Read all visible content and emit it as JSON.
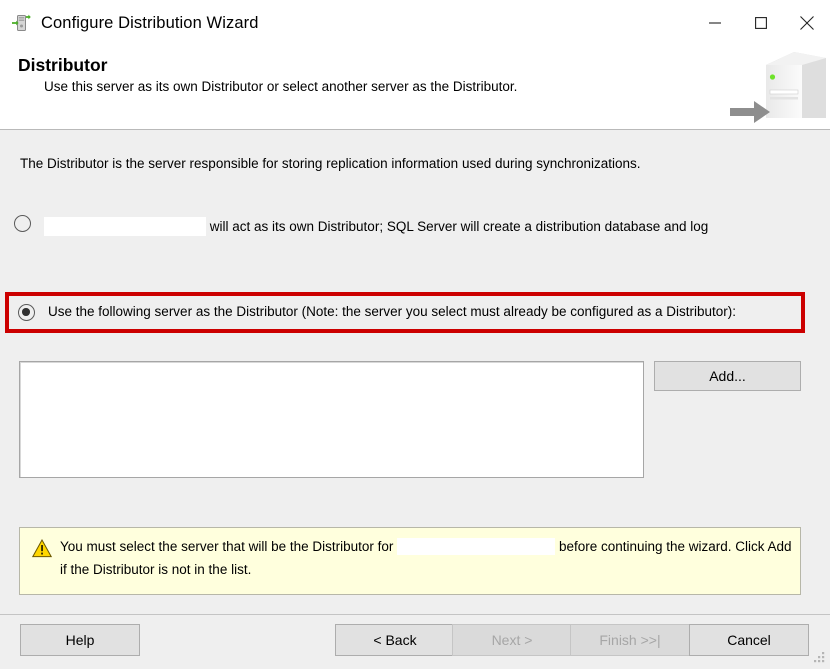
{
  "window": {
    "title": "Configure Distribution Wizard",
    "icon": "replication-server-icon",
    "controls": {
      "minimize_label": "Minimize",
      "maximize_label": "Maximize",
      "close_label": "Close"
    }
  },
  "header": {
    "title": "Distributor",
    "subtitle": "Use this server as its own Distributor or select another server as the Distributor.",
    "art": "server-tower-with-arrow-graphic"
  },
  "main": {
    "intro": "The Distributor is the server responsible for storing replication information used during synchronizations.",
    "options": [
      {
        "id": "own-distributor",
        "selected": false,
        "redacted_server_name": "",
        "text_after": "will act as its own Distributor; SQL Server will create a distribution database and log",
        "highlighted": false
      },
      {
        "id": "following-server",
        "selected": true,
        "text": "Use the following server as the Distributor (Note: the server you select must already be configured as a Distributor):",
        "highlighted": true,
        "highlight_color": "#cc0000"
      }
    ],
    "server_list": {
      "name": "distributor-server-list",
      "items": [],
      "empty": true
    },
    "add_button_label": "Add...",
    "warning": {
      "icon": "warning-triangle-icon",
      "text_before": "You must select the server that will be the Distributor for",
      "redacted_server_name": "",
      "text_after": "before continuing the wizard. Click Add if the Distributor is not in the list.",
      "background": "#ffffdd"
    }
  },
  "footer": {
    "buttons": [
      {
        "id": "help",
        "label": "Help",
        "enabled": true
      },
      {
        "id": "back",
        "label": "< Back",
        "enabled": true
      },
      {
        "id": "next",
        "label": "Next >",
        "enabled": false
      },
      {
        "id": "finish",
        "label": "Finish >>|",
        "enabled": false
      },
      {
        "id": "cancel",
        "label": "Cancel",
        "enabled": true
      }
    ]
  }
}
